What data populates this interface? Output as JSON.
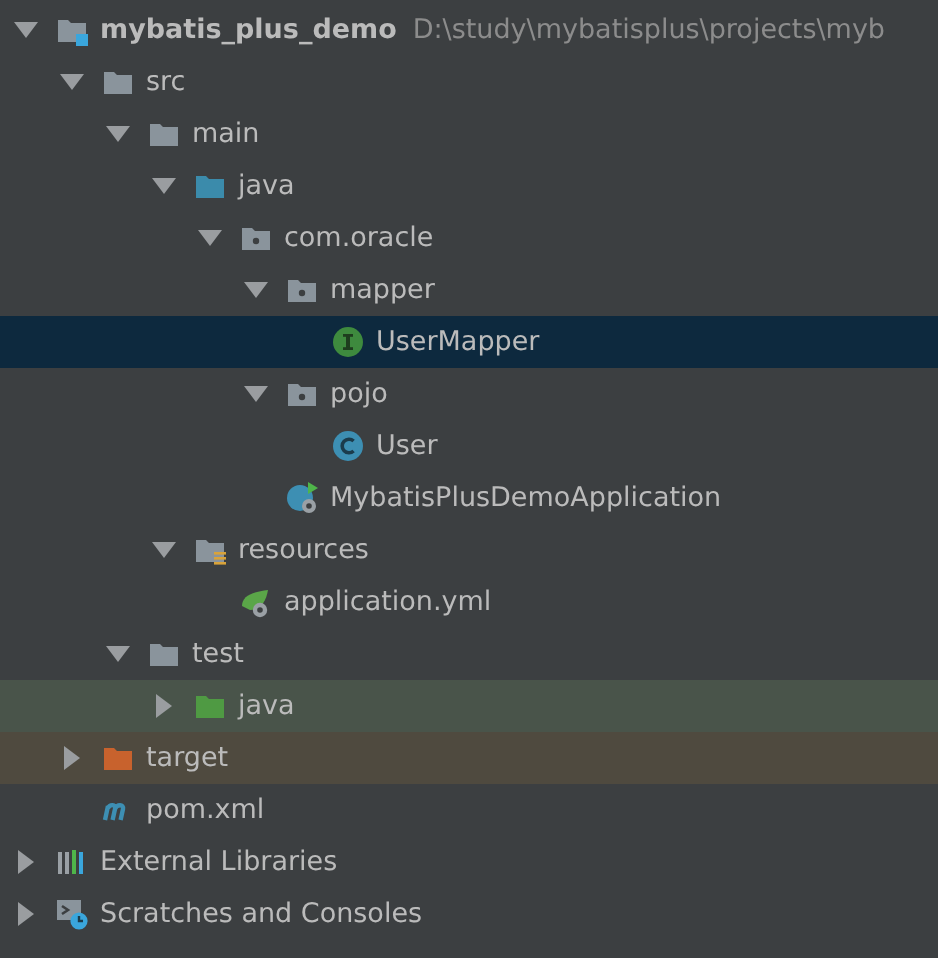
{
  "tree": [
    {
      "kind": "module",
      "label": "mybatis_plus_demo",
      "path": "D:\\study\\mybatisplus\\projects\\myb",
      "expanded": true,
      "selected": false,
      "children": [
        {
          "kind": "folder",
          "label": "src",
          "expanded": true,
          "selected": false,
          "children": [
            {
              "kind": "folder",
              "label": "main",
              "expanded": true,
              "selected": false,
              "children": [
                {
                  "kind": "source-folder",
                  "label": "java",
                  "expanded": true,
                  "selected": false,
                  "children": [
                    {
                      "kind": "package",
                      "label": "com.oracle",
                      "expanded": true,
                      "selected": false,
                      "children": [
                        {
                          "kind": "package",
                          "label": "mapper",
                          "expanded": true,
                          "selected": false,
                          "children": [
                            {
                              "kind": "interface",
                              "label": "UserMapper",
                              "selected": true
                            }
                          ]
                        },
                        {
                          "kind": "package",
                          "label": "pojo",
                          "expanded": true,
                          "selected": false,
                          "children": [
                            {
                              "kind": "class",
                              "label": "User",
                              "selected": false
                            }
                          ]
                        },
                        {
                          "kind": "spring-boot-class",
                          "label": "MybatisPlusDemoApplication",
                          "selected": false
                        }
                      ]
                    }
                  ]
                },
                {
                  "kind": "resources-folder",
                  "label": "resources",
                  "expanded": true,
                  "selected": false,
                  "children": [
                    {
                      "kind": "spring-config",
                      "label": "application.yml",
                      "selected": false
                    }
                  ]
                }
              ]
            },
            {
              "kind": "folder",
              "label": "test",
              "expanded": true,
              "selected": false,
              "children": [
                {
                  "kind": "test-folder",
                  "label": "java",
                  "expanded": false,
                  "selected": false
                }
              ]
            }
          ]
        },
        {
          "kind": "excluded-folder",
          "label": "target",
          "expanded": false,
          "selected": false
        },
        {
          "kind": "maven-file",
          "label": "pom.xml",
          "selected": false
        }
      ]
    },
    {
      "kind": "libraries",
      "label": "External Libraries",
      "expanded": false,
      "selected": false
    },
    {
      "kind": "scratches",
      "label": "Scratches and Consoles",
      "expanded": false,
      "selected": false
    }
  ]
}
